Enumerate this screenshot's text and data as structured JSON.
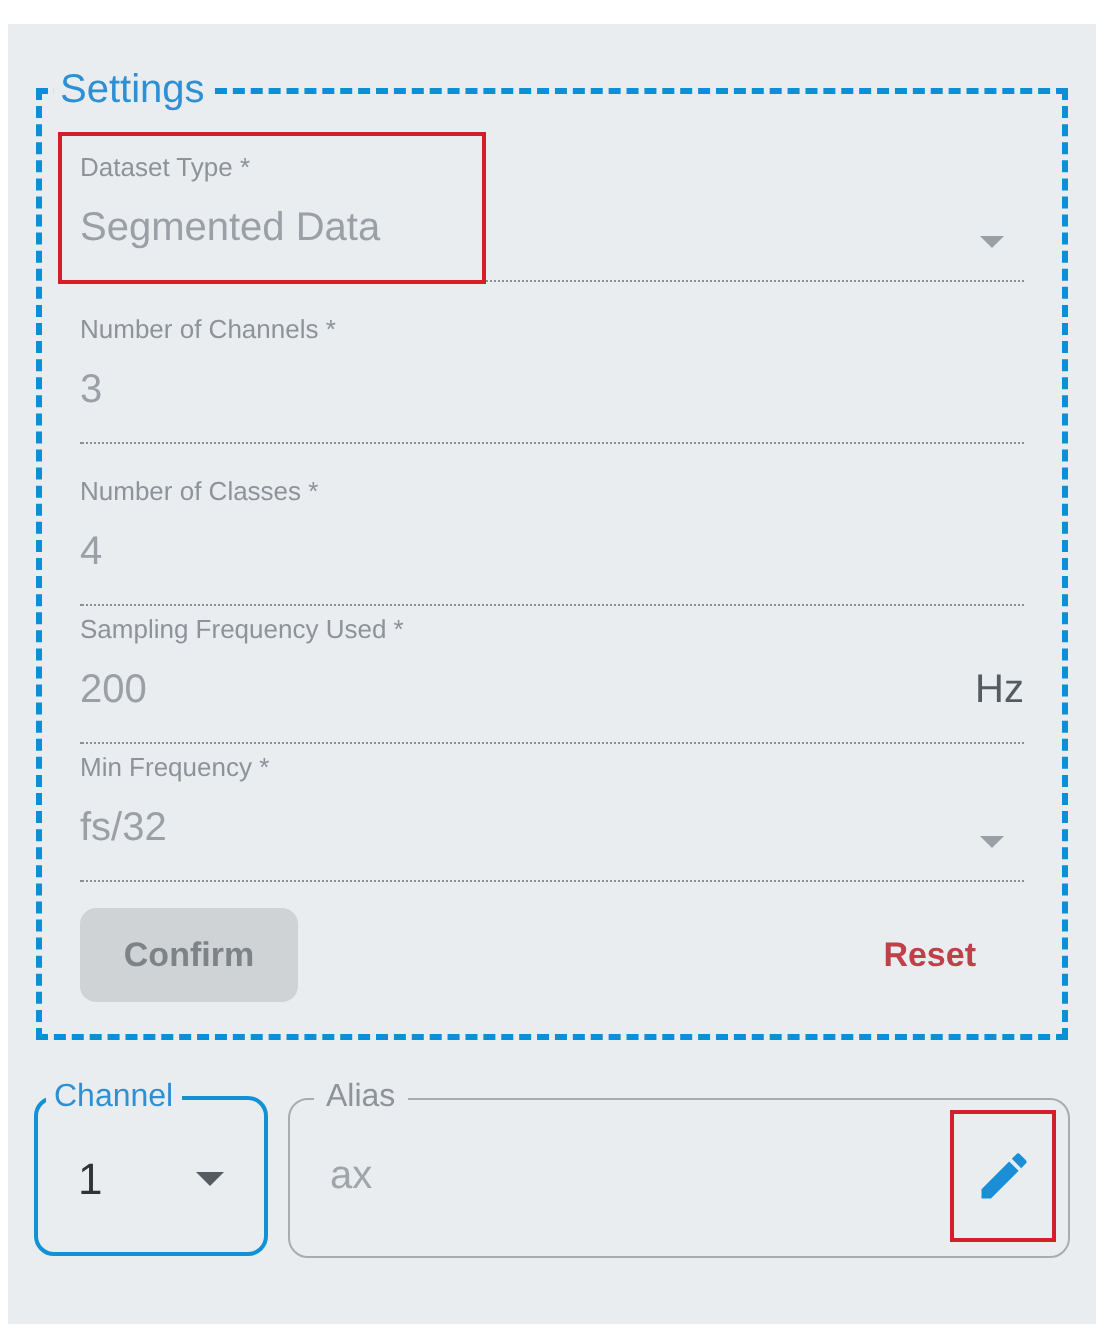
{
  "settings": {
    "legend": "Settings",
    "fields": [
      {
        "kind": "select",
        "label": "Dataset Type *",
        "value": "Segmented Data",
        "disabled": true,
        "highlighted": true
      },
      {
        "kind": "text",
        "label": "Number of Channels *",
        "value": "3",
        "disabled": true,
        "highlighted": false
      },
      {
        "kind": "text",
        "label": "Number of Classes *",
        "value": "4",
        "disabled": true,
        "highlighted": false
      },
      {
        "kind": "text",
        "label": "Sampling Frequency Used *",
        "value": "200",
        "suffix": "Hz",
        "disabled": true,
        "highlighted": false
      },
      {
        "kind": "select",
        "label": "Min Frequency *",
        "value": "fs/32",
        "disabled": true,
        "highlighted": false
      }
    ],
    "confirm_button": {
      "label": "Confirm",
      "disabled": true
    },
    "reset_button": {
      "label": "Reset"
    }
  },
  "channel_select": {
    "label": "Channel",
    "value": "1",
    "focused": true
  },
  "alias_field": {
    "label": "Alias",
    "value": "ax",
    "edit_highlighted": true
  }
}
